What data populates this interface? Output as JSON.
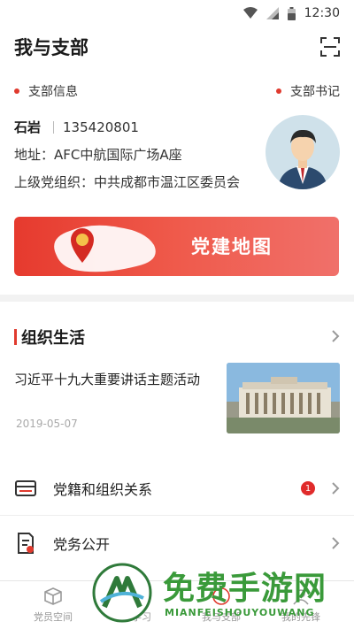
{
  "status_bar": {
    "time": "12:30"
  },
  "header": {
    "title": "我与支部"
  },
  "sections": {
    "branch_info": "支部信息",
    "branch_secretary": "支部书记"
  },
  "info": {
    "name": "石岩",
    "phone": "135420801",
    "address": "地址：AFC中航国际广场A座",
    "parent_org": "上级党组织：中共成都市温江区委员会"
  },
  "map_banner": {
    "label": "党建地图"
  },
  "org_life": {
    "title": "组织生活",
    "news": {
      "title": "习近平十九大重要讲话主题活动",
      "date": "2019-05-07"
    }
  },
  "list": [
    {
      "label": "党籍和组织关系",
      "badge": "1"
    },
    {
      "label": "党务公开"
    }
  ],
  "tabs": [
    {
      "label": "党员空间"
    },
    {
      "label": "学习"
    },
    {
      "label": "我与支部"
    },
    {
      "label": "我的先锋"
    }
  ],
  "watermark": {
    "title": "免费手游网",
    "subtitle": "MIANFEISHOUYOUWANG"
  },
  "colors": {
    "accent": "#e03a2e",
    "watermark": "#3a9a3a"
  }
}
